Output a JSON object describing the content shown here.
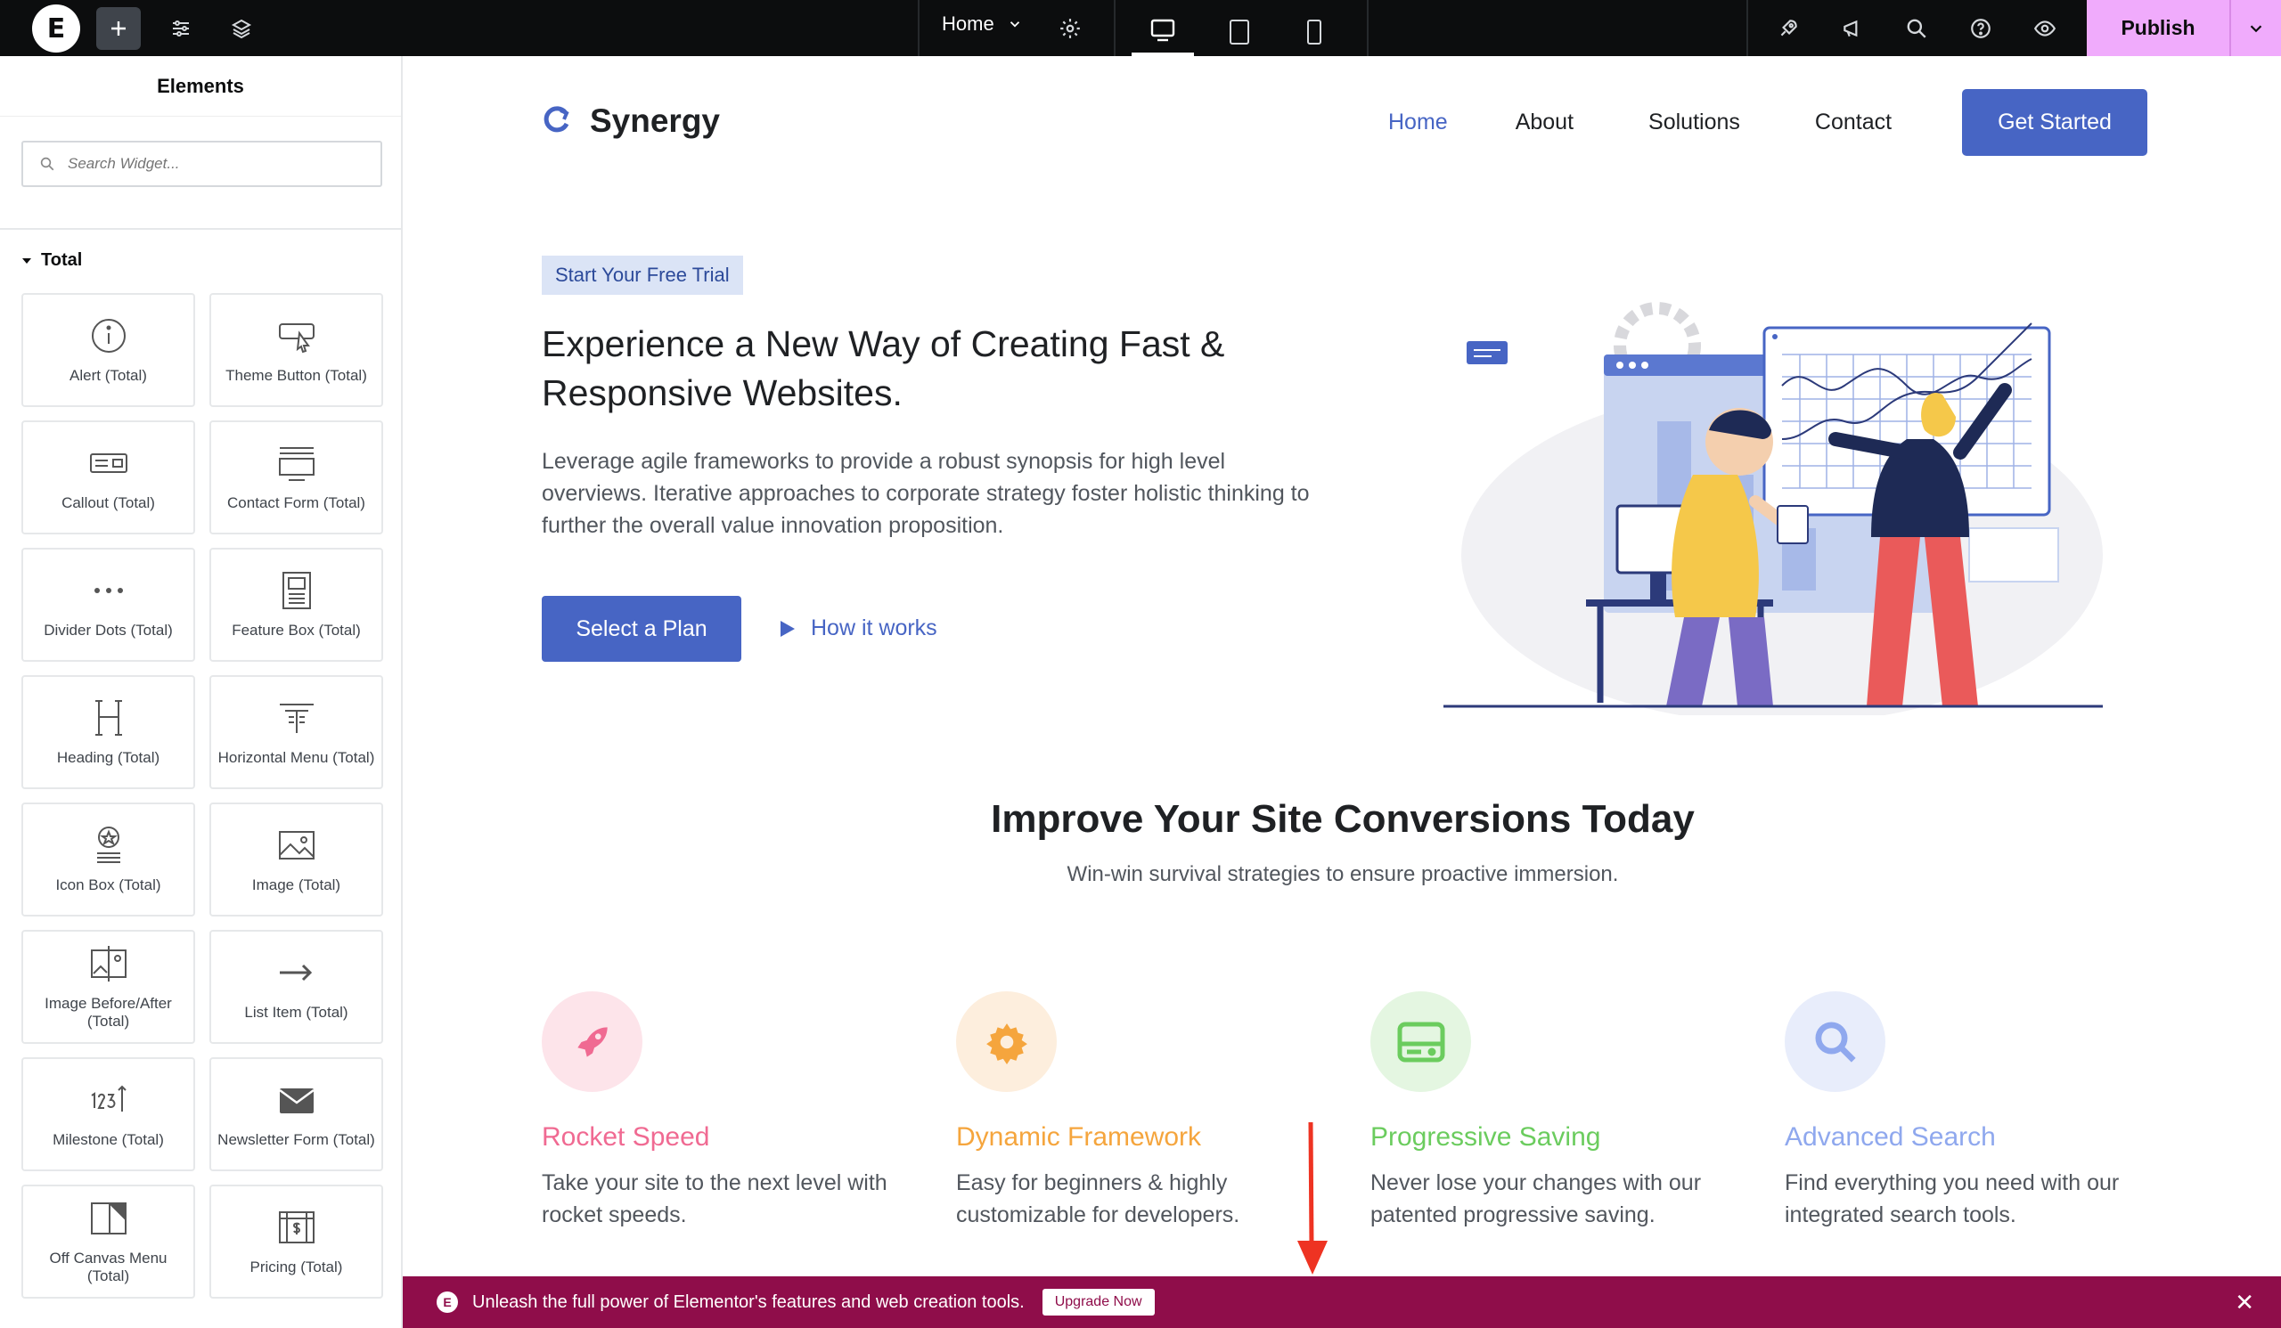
{
  "topbar": {
    "page_name": "Home",
    "publish_label": "Publish"
  },
  "sidebar": {
    "title": "Elements",
    "search_placeholder": "Search Widget...",
    "category": "Total",
    "widgets": [
      {
        "label": "Alert (Total)",
        "icon": "info-circle-icon"
      },
      {
        "label": "Theme Button (Total)",
        "icon": "cursor-button-icon"
      },
      {
        "label": "Callout (Total)",
        "icon": "callout-icon"
      },
      {
        "label": "Contact Form (Total)",
        "icon": "form-icon"
      },
      {
        "label": "Divider Dots (Total)",
        "icon": "dots-icon"
      },
      {
        "label": "Feature Box (Total)",
        "icon": "feature-box-icon"
      },
      {
        "label": "Heading (Total)",
        "icon": "heading-icon"
      },
      {
        "label": "Horizontal Menu (Total)",
        "icon": "menu-icon"
      },
      {
        "label": "Icon Box (Total)",
        "icon": "icon-box-icon"
      },
      {
        "label": "Image (Total)",
        "icon": "image-icon"
      },
      {
        "label": "Image Before/After (Total)",
        "icon": "before-after-icon"
      },
      {
        "label": "List Item (Total)",
        "icon": "arrow-right-icon"
      },
      {
        "label": "Milestone (Total)",
        "icon": "counter-icon"
      },
      {
        "label": "Newsletter Form (Total)",
        "icon": "envelope-icon"
      },
      {
        "label": "Off Canvas Menu (Total)",
        "icon": "off-canvas-icon"
      },
      {
        "label": "Pricing (Total)",
        "icon": "pricing-icon"
      }
    ]
  },
  "site": {
    "logo_text": "Synergy",
    "nav": [
      "Home",
      "About",
      "Solutions",
      "Contact"
    ],
    "nav_active": "Home",
    "cta": "Get Started",
    "badge": "Start Your Free Trial",
    "hero_title": "Experience a New Way of Creating Fast & Responsive Websites.",
    "hero_text": "Leverage agile frameworks to provide a robust synopsis for high level overviews. Iterative approaches to corporate strategy foster holistic thinking to further the overall value innovation proposition.",
    "primary_button": "Select a Plan",
    "secondary_link": "How it works",
    "section_title": "Improve Your Site Conversions Today",
    "section_subtitle": "Win-win survival strategies to ensure proactive immersion.",
    "features": [
      {
        "title": "Rocket Speed",
        "text": "Take your site to the next level with rocket speeds.",
        "color": "#f06a92",
        "bg": "#fde4ea",
        "icon": "rocket-icon"
      },
      {
        "title": "Dynamic Framework",
        "text": "Easy for beginners & highly customizable for developers.",
        "color": "#f5a53d",
        "bg": "#fdeedd",
        "icon": "gear-icon"
      },
      {
        "title": "Progressive Saving",
        "text": "Never lose your changes with our patented progressive saving.",
        "color": "#6bcc5e",
        "bg": "#e4f6e1",
        "icon": "hard-drive-icon"
      },
      {
        "title": "Advanced Search",
        "text": "Find everything you need with our integrated search tools.",
        "color": "#8fa8ee",
        "bg": "#e8edfb",
        "icon": "search-icon"
      }
    ]
  },
  "banner": {
    "message": "Unleash the full power of Elementor's features and web creation tools.",
    "button": "Upgrade Now"
  },
  "colors": {
    "brand": "#4765c4",
    "topbar": "#0c0d0e",
    "publish": "#f0abfc",
    "banner": "#8f0d4a"
  }
}
